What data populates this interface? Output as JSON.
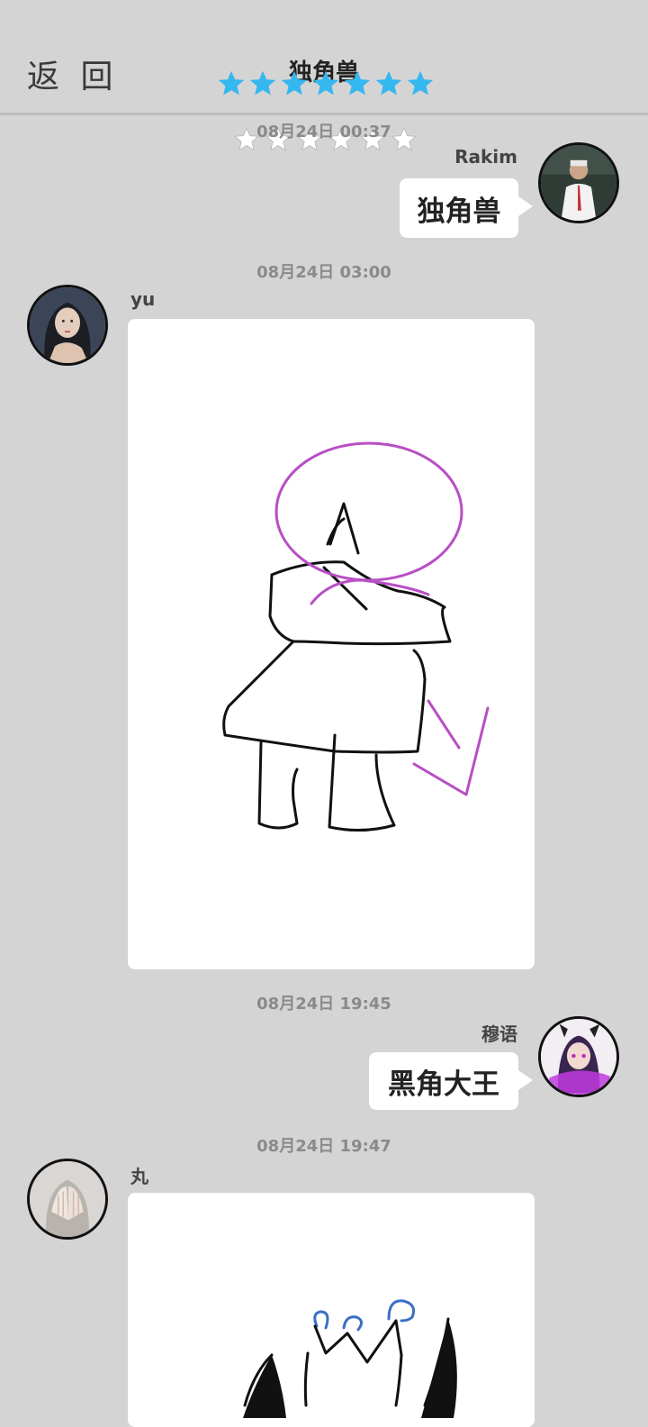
{
  "header": {
    "back_label": "返 回",
    "title": "独角兽"
  },
  "rating": {
    "blue_star_count": 7,
    "white_star_count": 6,
    "blue_color": "#35b7f0",
    "white_color": "#ffffff"
  },
  "messages": [
    {
      "timestamp": "08月24日  00:37",
      "sender": "Rakim",
      "side": "right",
      "type": "text",
      "text": "独角兽"
    },
    {
      "timestamp": "08月24日  03:00",
      "sender": "yu",
      "side": "left",
      "type": "image",
      "image_description": "unicorn-drawing"
    },
    {
      "timestamp": "08月24日  19:45",
      "sender": "穆语",
      "side": "right",
      "type": "text",
      "text": "黑角大王"
    },
    {
      "timestamp": "08月24日  19:47",
      "sender": "丸",
      "side": "left",
      "type": "image",
      "image_description": "crown-drawing"
    }
  ],
  "colors": {
    "background": "#d4d4d4",
    "bubble": "#ffffff",
    "drawing_black": "#111111",
    "drawing_purple": "#b84fc4",
    "drawing_blue": "#3a6fc4"
  }
}
